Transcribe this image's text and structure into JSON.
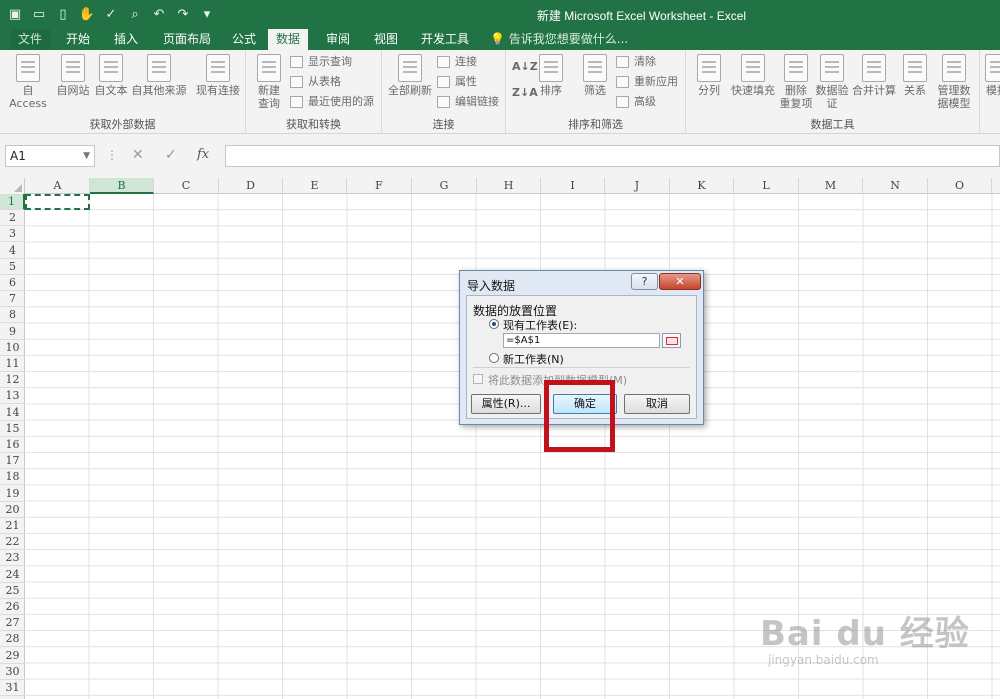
{
  "window": {
    "title": "新建 Microsoft Excel Worksheet - Excel"
  },
  "qat": {
    "icons": [
      "save-icon",
      "open-icon",
      "new-icon",
      "touch-mode-icon",
      "spelling-icon",
      "print-preview-icon",
      "undo-icon",
      "redo-icon",
      "customize-icon"
    ]
  },
  "tabs": [
    "文件",
    "开始",
    "插入",
    "页面布局",
    "公式",
    "数据",
    "审阅",
    "视图",
    "开发工具"
  ],
  "active_tab": "数据",
  "tellme": "告诉我您想要做什么...",
  "ribbon": {
    "get_external": {
      "label": "获取外部数据",
      "buttons": [
        "自 Access",
        "自网站",
        "自文本",
        "自其他来源",
        "现有连接"
      ]
    },
    "get_transform": {
      "label": "获取和转换",
      "new_query": [
        "新建",
        "查询"
      ],
      "small": [
        "显示查询",
        "从表格",
        "最近使用的源"
      ]
    },
    "connections": {
      "label": "连接",
      "refresh_all": [
        "全部刷新"
      ],
      "small": [
        "连接",
        "属性",
        "编辑链接"
      ]
    },
    "sort_filter": {
      "label": "排序和筛选",
      "sort": "排序",
      "filter": "筛选",
      "small": [
        "清除",
        "重新应用",
        "高级"
      ]
    },
    "data_tools": {
      "label": "数据工具",
      "buttons": [
        "分列",
        "快速填充",
        "删除",
        "重复项",
        "数据验",
        "证",
        "合并计算",
        "关系",
        "管理数",
        "据模型",
        "模拟"
      ]
    }
  },
  "formula_bar": {
    "name_box": "A1",
    "fx": "fx",
    "value": ""
  },
  "grid": {
    "columns": [
      "A",
      "B",
      "C",
      "D",
      "E",
      "F",
      "G",
      "H",
      "I",
      "J",
      "K",
      "L",
      "M",
      "N",
      "O"
    ],
    "rows": [
      "1",
      "2",
      "3",
      "4",
      "5",
      "6",
      "7",
      "8",
      "9",
      "10",
      "11",
      "12",
      "13",
      "14",
      "15",
      "16",
      "17",
      "18",
      "19",
      "20",
      "21",
      "22",
      "23",
      "24",
      "25",
      "26",
      "27",
      "28",
      "29",
      "30",
      "31"
    ],
    "selected_column": "B",
    "selected_row": "1"
  },
  "dialog": {
    "title": "导入数据",
    "help": "?",
    "close": "✕",
    "section": "数据的放置位置",
    "option_existing": "现有工作表(E):",
    "reference": "=$A$1",
    "option_new": "新工作表(N)",
    "add_model": "将此数据添加到数据模型(M)",
    "btn_properties": "属性(R)...",
    "btn_ok": "确定",
    "btn_cancel": "取消"
  },
  "watermark": {
    "main": "Bai du 经验",
    "sub": "jingyan.baidu.com"
  },
  "colors": {
    "accent": "#217346",
    "highlight": "#c1121b"
  }
}
